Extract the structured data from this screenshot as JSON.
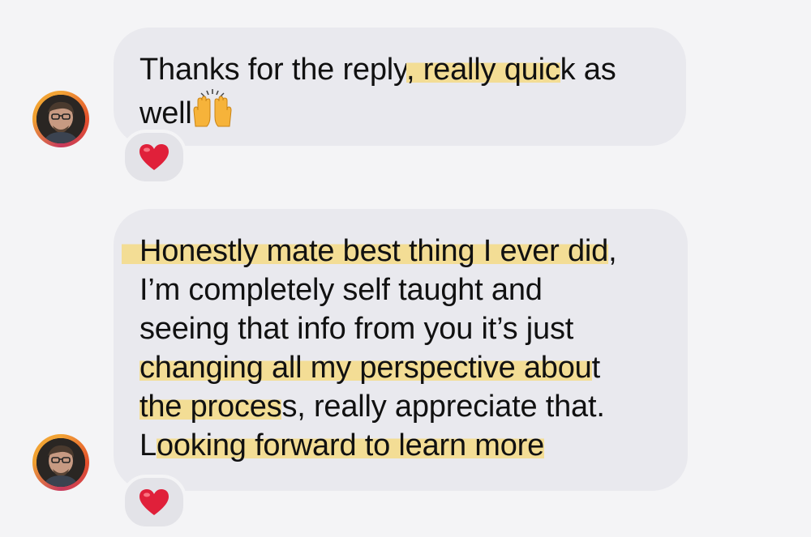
{
  "thread": {
    "messages": [
      {
        "lines": [
          [
            {
              "text": "Thanks for the reply",
              "hl": false
            },
            {
              "text": ", really quic",
              "hl": true
            },
            {
              "text": "k as",
              "hl": false
            }
          ],
          [
            {
              "text": "well",
              "hl": false
            }
          ]
        ],
        "emoji": "raising-hands",
        "reaction": "heart"
      },
      {
        "lines": [
          [
            {
              "text": "Honestly mate best thing I ever did",
              "hl": true
            },
            {
              "text": ",",
              "hl": false
            }
          ],
          [
            {
              "text": "I’m completely self taught and",
              "hl": false
            }
          ],
          [
            {
              "text": "seeing that info from you it’s just",
              "hl": false
            }
          ],
          [
            {
              "text": "changing all my perspective abou",
              "hl": true
            },
            {
              "text": "t",
              "hl": false
            }
          ],
          [
            {
              "text": "the proces",
              "hl": true
            },
            {
              "text": "s, really appreciate that.",
              "hl": false
            }
          ],
          [
            {
              "text": "L",
              "hl": false
            },
            {
              "text": "ooking forward to learn more",
              "hl": true
            }
          ]
        ],
        "reaction": "heart"
      }
    ]
  },
  "colors": {
    "background": "#f4f4f6",
    "bubble": "#e9e9ee",
    "highlight": "#f3dd95",
    "heart": "#e0203a",
    "avatar_ring": "#e4502c"
  }
}
